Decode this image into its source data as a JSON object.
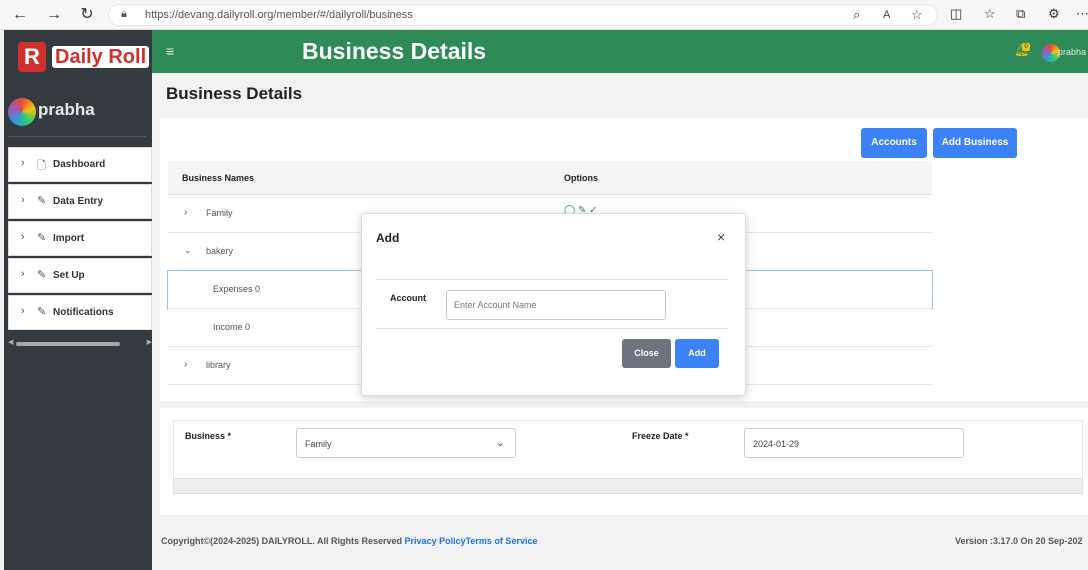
{
  "browser": {
    "url": "https://devang.dailyroll.org/member/#/dailyroll/business"
  },
  "sidebar": {
    "logo_letter": "R",
    "logo_text": "Daily Roll",
    "user_name": "prabha",
    "items": [
      {
        "label": "Dashboard",
        "icon": "file-icon"
      },
      {
        "label": "Data Entry",
        "icon": "pencil-icon"
      },
      {
        "label": "Import",
        "icon": "pencil-icon"
      },
      {
        "label": "Set Up",
        "icon": "pencil-icon"
      },
      {
        "label": "Notifications",
        "icon": "pencil-icon"
      }
    ]
  },
  "header": {
    "title": "Business Details",
    "bell_badge": "0",
    "user": "prabha"
  },
  "page": {
    "title": "Business Details"
  },
  "actions": {
    "accounts_label": "Accounts",
    "add_business_label": "Add Business"
  },
  "table": {
    "headers": [
      "Business Names",
      "Options"
    ],
    "rows": [
      {
        "label": "Family",
        "expanded": false,
        "level": 0
      },
      {
        "label": "bakery",
        "expanded": true,
        "level": 0
      },
      {
        "label": "Expenses 0",
        "level": 1,
        "selected": true
      },
      {
        "label": "Income 0",
        "level": 1
      },
      {
        "label": "library",
        "expanded": false,
        "level": 0
      }
    ]
  },
  "form": {
    "business_label": "Business *",
    "business_value": "Family",
    "freeze_label": "Freeze Date *",
    "freeze_value": "2024-01-29"
  },
  "footer": {
    "copyright": "Copyright©(2024-2025) DAILYROLL. All Rights Reserved",
    "privacy": "Privacy Policy",
    "terms": "Terms of Service",
    "version": "Version :3.17.0 On 20 Sep-202"
  },
  "modal": {
    "title": "Add",
    "close_symbol": "×",
    "account_label": "Account",
    "account_placeholder": "Enter Account Name",
    "account_value": "",
    "close_label": "Close",
    "add_label": "Add"
  }
}
